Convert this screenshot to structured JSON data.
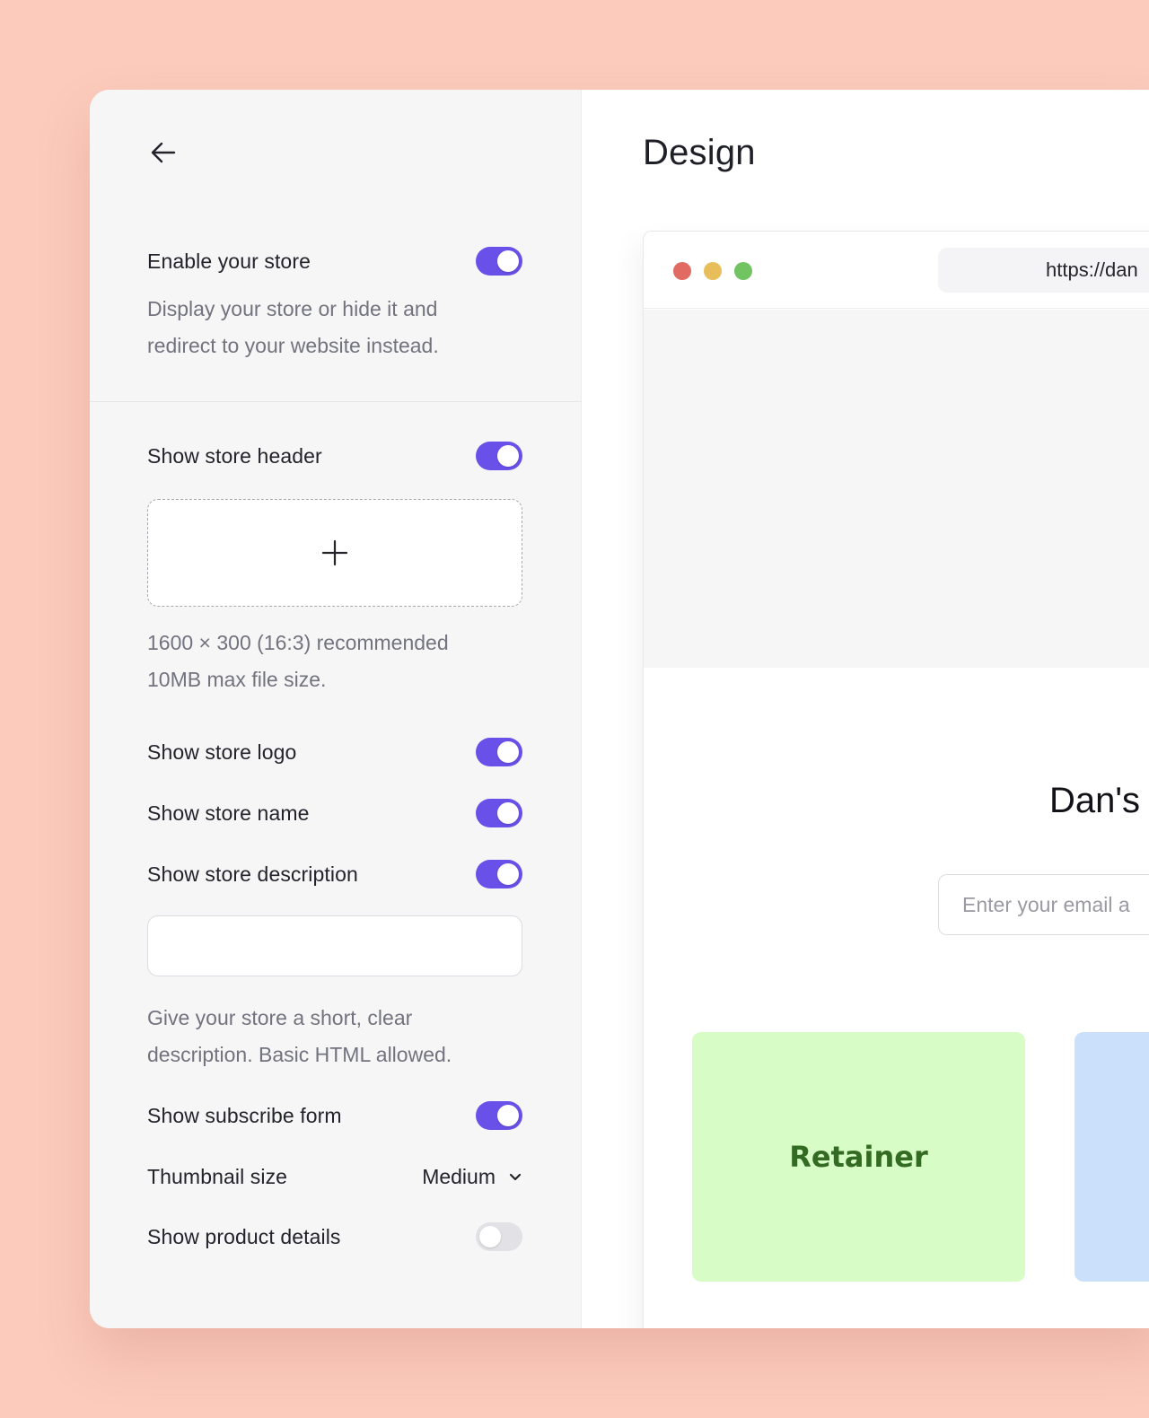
{
  "sidebar": {
    "back_icon": "arrow-left-icon",
    "enable_store": {
      "label": "Enable your store",
      "on": true,
      "help_line1": "Display your store or hide it and",
      "help_line2": "redirect to your website instead."
    },
    "show_header": {
      "label": "Show store header",
      "on": true,
      "upload_icon": "plus-icon",
      "help_line1": "1600 × 300 (16:3) recommended",
      "help_line2": "10MB max file size."
    },
    "show_logo": {
      "label": "Show store logo",
      "on": true
    },
    "show_name": {
      "label": "Show store name",
      "on": true
    },
    "show_description": {
      "label": "Show store description",
      "on": true,
      "value": "",
      "help_line1": "Give your store a short, clear",
      "help_line2": "description. Basic HTML allowed."
    },
    "show_subscribe": {
      "label": "Show subscribe form",
      "on": true
    },
    "thumbnail_size": {
      "label": "Thumbnail size",
      "value": "Medium",
      "icon": "chevron-down-icon"
    },
    "show_product_details": {
      "label": "Show product details",
      "on": false
    }
  },
  "main": {
    "title": "Design",
    "preview": {
      "url": "https://dan",
      "store_name": "Dan's",
      "email_placeholder": "Enter your email a",
      "cards": [
        {
          "title": "Retainer",
          "color": "#d7fcc6"
        },
        {
          "title": "",
          "color": "#cbe0fb"
        }
      ]
    }
  },
  "colors": {
    "background": "#fccbbc",
    "accent": "#6950e8",
    "toggle_off": "#e2e2e6",
    "traffic_red": "#e16a63",
    "traffic_yellow": "#e8be5a",
    "traffic_green": "#72c462",
    "card_text": "#336b23"
  }
}
